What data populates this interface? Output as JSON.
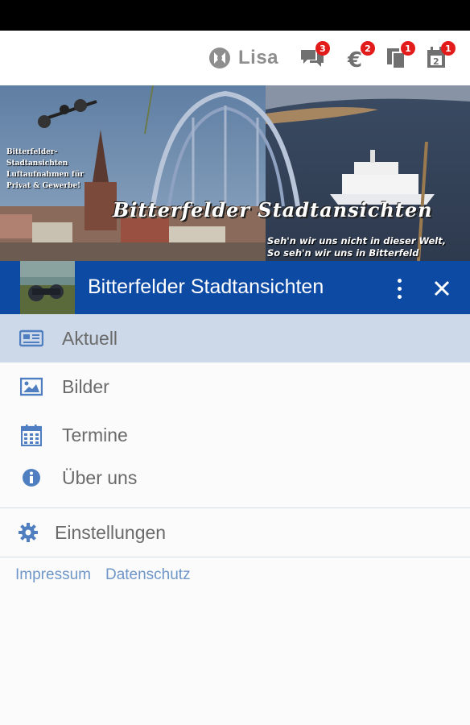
{
  "header": {
    "brand_label": "Lisa",
    "icons": [
      {
        "name": "chat-icon",
        "badge": "3"
      },
      {
        "name": "euro-icon",
        "badge": "2"
      },
      {
        "name": "documents-icon",
        "badge": "1"
      },
      {
        "name": "calendar-icon",
        "badge": "1"
      }
    ]
  },
  "banner": {
    "title": "Bitterfelder Stadtansichten",
    "sub_lines": [
      "Bitterfelder-Stadtansichten",
      "Luftaufnahmen für",
      "Privat & Gewerbe!"
    ],
    "motto_lines": [
      "Seh'n wir uns nicht in dieser Welt,",
      "So seh'n wir uns in Bitterfeld"
    ]
  },
  "drawer": {
    "title": "Bitterfelder Stadtansichten",
    "accent_color": "#0d4aa4"
  },
  "menu": {
    "items": [
      {
        "label": "Aktuell",
        "icon": "newspaper-icon",
        "active": true
      },
      {
        "label": "Bilder",
        "icon": "image-icon"
      },
      {
        "label": "Termine",
        "icon": "calendar-grid-icon"
      },
      {
        "label": "Über uns",
        "icon": "info-icon"
      },
      {
        "label": "Einstellungen",
        "icon": "gear-icon"
      }
    ]
  },
  "footer": {
    "links": [
      "Impressum",
      "Datenschutz"
    ]
  }
}
